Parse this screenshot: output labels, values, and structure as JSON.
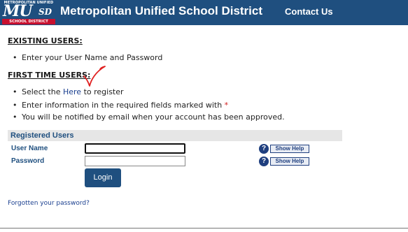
{
  "header": {
    "logo": {
      "top_text": "METROPOLITAN UNIFIED",
      "mark": "MU",
      "mark_suffix": "SD",
      "bottom_text": "SCHOOL DISTRICT"
    },
    "title": "Metropolitan Unified School District",
    "contact_label": "Contact Us"
  },
  "existing_users": {
    "heading": "EXISTING USERS:",
    "items": [
      "Enter your User Name and Password"
    ]
  },
  "first_time_users": {
    "heading": "FIRST TIME USERS:",
    "item1_prefix": "Select the ",
    "item1_link": "Here",
    "item1_suffix": " to register",
    "item2_text": "Enter information in the required fields marked with ",
    "item2_required_mark": "*",
    "item3_text": "You will be notified by email when your account has been approved."
  },
  "login_panel": {
    "title": "Registered Users",
    "username_label": "User Name",
    "username_value": "",
    "password_label": "Password",
    "password_value": "",
    "help_icon_glyph": "?",
    "help_label": "Show Help",
    "login_label": "Login"
  },
  "forgot_link": "Forgotten your password?",
  "annotation": {
    "icon": "red-checkmark",
    "color": "#e02020"
  },
  "colors": {
    "brand": "#1f4f7f",
    "accent_red": "#c8102e",
    "link": "#1a3f8f"
  }
}
